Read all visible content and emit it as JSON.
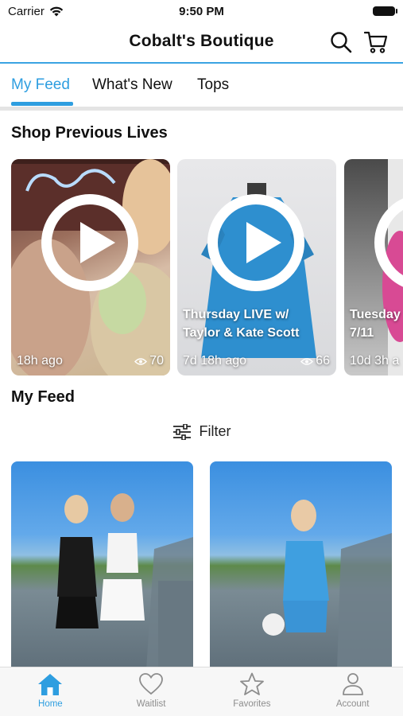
{
  "status_bar": {
    "carrier": "Carrier",
    "time": "9:50 PM"
  },
  "header": {
    "title": "Cobalt's Boutique"
  },
  "tabs": [
    {
      "label": "My Feed",
      "active": true
    },
    {
      "label": "What's New",
      "active": false
    },
    {
      "label": "Tops",
      "active": false
    }
  ],
  "previous_lives": {
    "title": "Shop Previous Lives",
    "cards": [
      {
        "caption_line1": "",
        "caption_line2": "",
        "ago": "18h ago",
        "views": "70"
      },
      {
        "caption_line1": "Thursday LIVE w/",
        "caption_line2": "Taylor & Kate Scott",
        "ago": "7d 18h ago",
        "views": "66"
      },
      {
        "caption_line1": "Tuesday",
        "caption_line2": "7/11",
        "ago": "10d 3h a",
        "views": ""
      }
    ]
  },
  "feed": {
    "title": "My Feed",
    "filter_label": "Filter"
  },
  "bottom_nav": [
    {
      "label": "Home",
      "icon": "home-icon",
      "active": true
    },
    {
      "label": "Waitlist",
      "icon": "heart-icon",
      "active": false
    },
    {
      "label": "Favorites",
      "icon": "star-icon",
      "active": false
    },
    {
      "label": "Account",
      "icon": "person-icon",
      "active": false
    }
  ],
  "colors": {
    "accent": "#2e9ee0",
    "header_rule": "#3aa3e3",
    "inactive": "#8d8d8d"
  }
}
